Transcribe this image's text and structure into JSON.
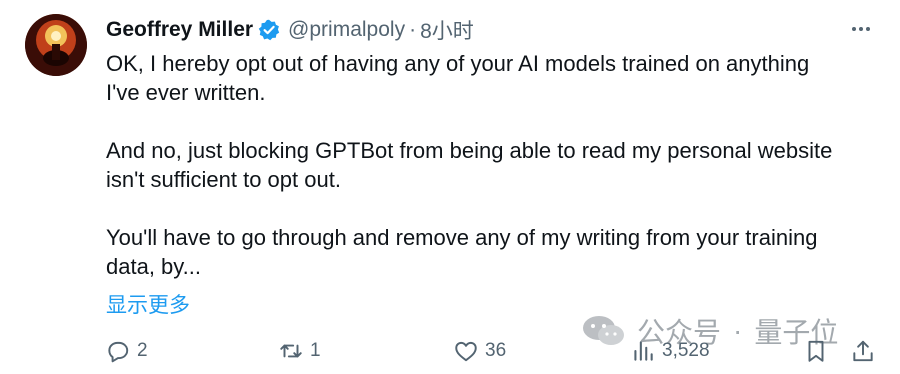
{
  "author": {
    "name": "Geoffrey Miller",
    "handle": "@primalpoly",
    "separator": "·",
    "time": "8小时"
  },
  "tweet": {
    "paragraphs": [
      "OK, I hereby opt out of having any of your AI models trained on anything\nI've ever written.",
      "And no, just blocking GPTBot from being able to read my personal website\nisn't sufficient to opt out.",
      "You'll have to go through and remove any of my writing from your training\ndata, by..."
    ],
    "show_more": "显示更多"
  },
  "watermark": {
    "source": "公众号",
    "separator": "·",
    "name": "量子位"
  },
  "actions": {
    "replies": "2",
    "reposts": "1",
    "likes": "36",
    "views": "3,528"
  },
  "colors": {
    "text": "#0f1419",
    "secondary": "#536471",
    "link": "#1d9bf0",
    "verified": "#1d9bf0"
  },
  "icons": {
    "avatar": "avatar-image",
    "verified": "verified-badge-icon",
    "more": "more-horizontal-icon",
    "reply": "reply-icon",
    "repost": "repost-icon",
    "like": "heart-icon",
    "views": "views-chart-icon",
    "bookmark": "bookmark-icon",
    "share": "share-icon",
    "wechat": "wechat-icon"
  }
}
